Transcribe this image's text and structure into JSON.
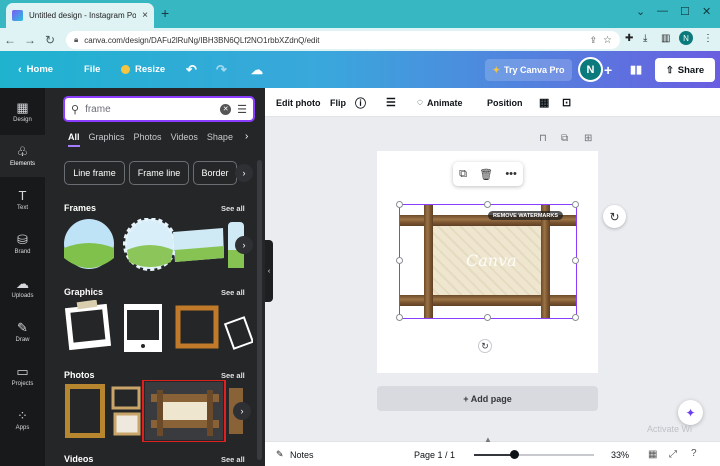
{
  "browser": {
    "tab_title": "Untitled design - Instagram Post",
    "tab_close": "×",
    "new_tab": "+",
    "url": "canva.com/design/DAFu2lRuNg/IBH3BN6QLf2NO1rbbXZdnQ/edit",
    "profile_initial": "N",
    "window_controls": [
      "⌄",
      "—",
      "☐",
      "✕"
    ]
  },
  "topbar": {
    "home": "Home",
    "file": "File",
    "resize": "Resize",
    "try_pro": "Try Canva Pro",
    "avatar": "N",
    "share": "Share"
  },
  "rail": [
    {
      "label": "Design",
      "icon": "layout-icon",
      "glyph": "▦"
    },
    {
      "label": "Elements",
      "icon": "shapes-icon",
      "glyph": "♧",
      "active": true
    },
    {
      "label": "Text",
      "icon": "text-icon",
      "glyph": "T"
    },
    {
      "label": "Brand",
      "icon": "brand-icon",
      "glyph": "⛁"
    },
    {
      "label": "Uploads",
      "icon": "upload-icon",
      "glyph": "☁"
    },
    {
      "label": "Draw",
      "icon": "draw-icon",
      "glyph": "✎"
    },
    {
      "label": "Projects",
      "icon": "folder-icon",
      "glyph": "▭"
    },
    {
      "label": "Apps",
      "icon": "apps-icon",
      "glyph": "⁘"
    }
  ],
  "panel": {
    "search_value": "frame",
    "filter_tabs": [
      "All",
      "Graphics",
      "Photos",
      "Videos",
      "Shape"
    ],
    "chips": [
      "Line frame",
      "Frame line",
      "Border"
    ],
    "sections": {
      "frames": "Frames",
      "graphics": "Graphics",
      "photos": "Photos",
      "videos": "Videos"
    },
    "see_all": "See all"
  },
  "context_toolbar": {
    "edit_photo": "Edit photo",
    "flip": "Flip",
    "animate": "Animate",
    "position": "Position"
  },
  "canvas": {
    "watermark_label": "REMOVE WATERMARKS",
    "watermark_text": "Canva",
    "add_page": "+ Add page"
  },
  "bottombar": {
    "notes": "Notes",
    "page_indicator": "Page 1 / 1",
    "zoom": "33%",
    "zoom_level": 0.33,
    "activate_hint": "Activate Wi"
  },
  "colors": {
    "accent": "#8b3dff",
    "chrome_teal": "#37b7c2",
    "selection_red": "#e02020"
  }
}
